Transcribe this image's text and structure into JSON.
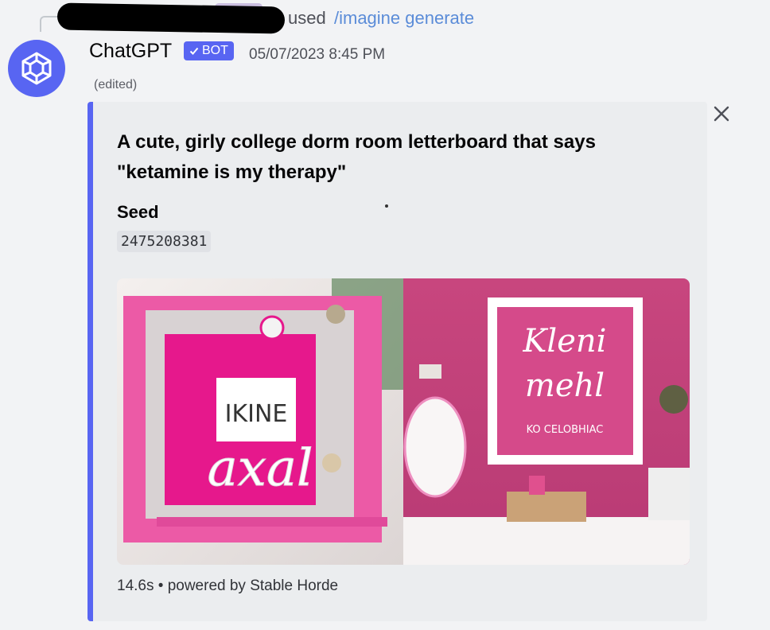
{
  "reply": {
    "used_text": "used",
    "command": "/imagine generate"
  },
  "message": {
    "author": "ChatGPT",
    "bot_tag": "BOT",
    "timestamp": "05/07/2023 8:45 PM",
    "edited": "(edited)"
  },
  "embed": {
    "title_line1": "A cute, girly college dorm room letterboard that says",
    "title_line2": "\"ketamine is my therapy\"",
    "field_name": "Seed",
    "field_value": "2475208381",
    "footer": "14.6s • powered by Stable Horde",
    "accent_color": "#5865f2"
  },
  "image_text": {
    "left_board": "IKINE",
    "left_script": "axal",
    "right_script1": "Kleni",
    "right_script2": "mehl",
    "right_small": "KO CELOBHIAC"
  },
  "icons": [
    "reply-line-icon",
    "avatar-cube-icon",
    "checkmark-icon",
    "close-icon"
  ]
}
